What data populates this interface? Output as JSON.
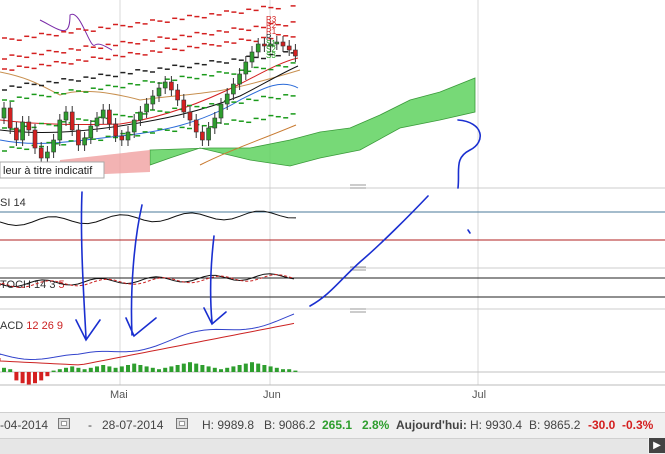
{
  "tooltip": "leur à titre indicatif",
  "panels": {
    "rsi": {
      "label": "SI",
      "param": "14"
    },
    "stoch": {
      "label": "TOCH",
      "p1": "14",
      "p2": "3",
      "p3": "5"
    },
    "macd": {
      "label": "ACD",
      "p1": "12",
      "p2": "26",
      "p3": "9"
    }
  },
  "xaxis": {
    "ticks": [
      "Mai",
      "Jun",
      "Jul"
    ]
  },
  "footer": {
    "from_date": "-04-2014",
    "dash": "-",
    "to_date": "28-07-2014",
    "h_label": "H:",
    "h_value": "9989.8",
    "b_label": "B:",
    "b_value": "9086.2",
    "change": "265.1",
    "change_pct": "2.8%",
    "today_label": "Aujourd'hui",
    "today_colon": ":",
    "today_h_label": "H:",
    "today_h": "9930.4",
    "today_b_label": "B:",
    "today_b": "9865.2",
    "today_change": "-30.0",
    "today_pct": "-0.3%"
  },
  "colors": {
    "up": "#2e9e2e",
    "down": "#d42020",
    "cloud": "#5fd25f",
    "cloud_red": "#f0a0a0",
    "macd": "#3344cc",
    "signal": "#cc2222",
    "rsi_line": "#111111",
    "ink": "#1a2fd0"
  },
  "chart_data": {
    "type": "candlestick",
    "pivot_labels": [
      "R3",
      "R2",
      "R1",
      "P",
      "S1",
      "S2",
      "S3"
    ],
    "candles": [
      {
        "o": 118,
        "c": 108
      },
      {
        "o": 108,
        "c": 128
      },
      {
        "o": 128,
        "c": 140
      },
      {
        "o": 140,
        "c": 122
      },
      {
        "o": 122,
        "c": 130
      },
      {
        "o": 130,
        "c": 148
      },
      {
        "o": 148,
        "c": 158
      },
      {
        "o": 158,
        "c": 152
      },
      {
        "o": 152,
        "c": 140
      },
      {
        "o": 140,
        "c": 120
      },
      {
        "o": 120,
        "c": 112
      },
      {
        "o": 112,
        "c": 130
      },
      {
        "o": 130,
        "c": 145
      },
      {
        "o": 145,
        "c": 138
      },
      {
        "o": 138,
        "c": 126
      },
      {
        "o": 126,
        "c": 118
      },
      {
        "o": 118,
        "c": 110
      },
      {
        "o": 110,
        "c": 124
      },
      {
        "o": 124,
        "c": 136
      },
      {
        "o": 136,
        "c": 140
      },
      {
        "o": 140,
        "c": 132
      },
      {
        "o": 132,
        "c": 120
      },
      {
        "o": 120,
        "c": 112
      },
      {
        "o": 112,
        "c": 104
      },
      {
        "o": 104,
        "c": 96
      },
      {
        "o": 96,
        "c": 88
      },
      {
        "o": 88,
        "c": 82
      },
      {
        "o": 82,
        "c": 90
      },
      {
        "o": 90,
        "c": 100
      },
      {
        "o": 100,
        "c": 112
      },
      {
        "o": 112,
        "c": 120
      },
      {
        "o": 120,
        "c": 132
      },
      {
        "o": 132,
        "c": 140
      },
      {
        "o": 140,
        "c": 128
      },
      {
        "o": 128,
        "c": 118
      },
      {
        "o": 118,
        "c": 104
      },
      {
        "o": 104,
        "c": 94
      },
      {
        "o": 94,
        "c": 84
      },
      {
        "o": 84,
        "c": 74
      },
      {
        "o": 74,
        "c": 62
      },
      {
        "o": 62,
        "c": 52
      },
      {
        "o": 52,
        "c": 44
      },
      {
        "o": 44,
        "c": 46
      },
      {
        "o": 46,
        "c": 44
      },
      {
        "o": 44,
        "c": 42
      },
      {
        "o": 42,
        "c": 46
      },
      {
        "o": 46,
        "c": 50
      },
      {
        "o": 50,
        "c": 56
      }
    ],
    "macd_hist": [
      3,
      2,
      -6,
      -8,
      -9,
      -8,
      -6,
      -3,
      1,
      2,
      3,
      4,
      3,
      2,
      3,
      4,
      5,
      4,
      3,
      4,
      5,
      6,
      5,
      4,
      3,
      2,
      3,
      4,
      5,
      6,
      7,
      6,
      5,
      4,
      3,
      2,
      3,
      4,
      5,
      6,
      7,
      6,
      5,
      4,
      3,
      2,
      2,
      1
    ]
  }
}
